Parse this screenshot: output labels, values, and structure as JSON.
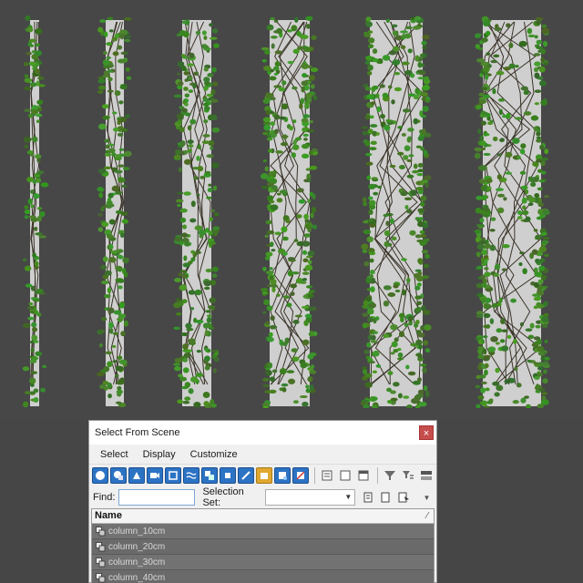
{
  "dialog": {
    "title": "Select From Scene",
    "close_symbol": "×",
    "menu": [
      "Select",
      "Display",
      "Customize"
    ],
    "find_label": "Find:",
    "find_value": "",
    "selection_set_label": "Selection Set:",
    "selection_set_value": "",
    "list_header": "Name",
    "rows": [
      "column_10cm",
      "column_20cm",
      "column_30cm",
      "column_40cm"
    ]
  },
  "colors": {
    "viewport_bg": "#474747",
    "concrete": "#cfcfcf",
    "ivy": "#4d8a2e",
    "toolbar_blue": "#2c73c4"
  },
  "icons": {
    "toolbar": [
      "sphere-icon",
      "multi-shape-icon",
      "lights-icon",
      "cameras-icon",
      "helpers-icon",
      "spacewarps-icon",
      "groups-icon",
      "xrefs-icon",
      "bones-icon",
      "containers-icon",
      "frozen-icon",
      "hidden-icon"
    ],
    "row": "object-icon"
  }
}
